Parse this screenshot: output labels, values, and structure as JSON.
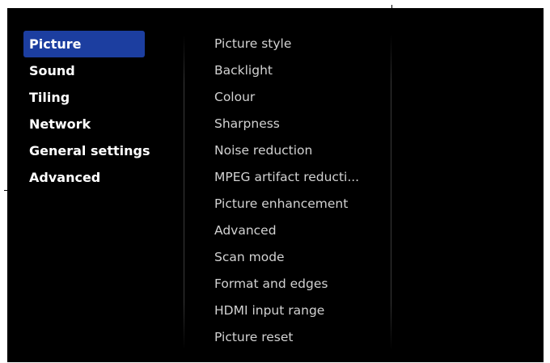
{
  "main_menu": {
    "items": [
      {
        "label": "Picture",
        "selected": true
      },
      {
        "label": "Sound",
        "selected": false
      },
      {
        "label": "Tiling",
        "selected": false
      },
      {
        "label": "Network",
        "selected": false
      },
      {
        "label": "General settings",
        "selected": false
      },
      {
        "label": "Advanced",
        "selected": false
      }
    ]
  },
  "picture_menu": {
    "items": [
      {
        "label": "Picture style"
      },
      {
        "label": "Backlight"
      },
      {
        "label": "Colour"
      },
      {
        "label": "Sharpness"
      },
      {
        "label": "Noise reduction"
      },
      {
        "label": "MPEG artifact reducti..."
      },
      {
        "label": "Picture enhancement"
      },
      {
        "label": "Advanced"
      },
      {
        "label": "Scan mode"
      },
      {
        "label": "Format and edges"
      },
      {
        "label": "HDMI input range"
      },
      {
        "label": "Picture reset"
      }
    ]
  },
  "colors": {
    "background": "#000000",
    "highlight": "#1c3ea0",
    "primary_text": "#ffffff",
    "secondary_text": "#d2d2d2"
  }
}
